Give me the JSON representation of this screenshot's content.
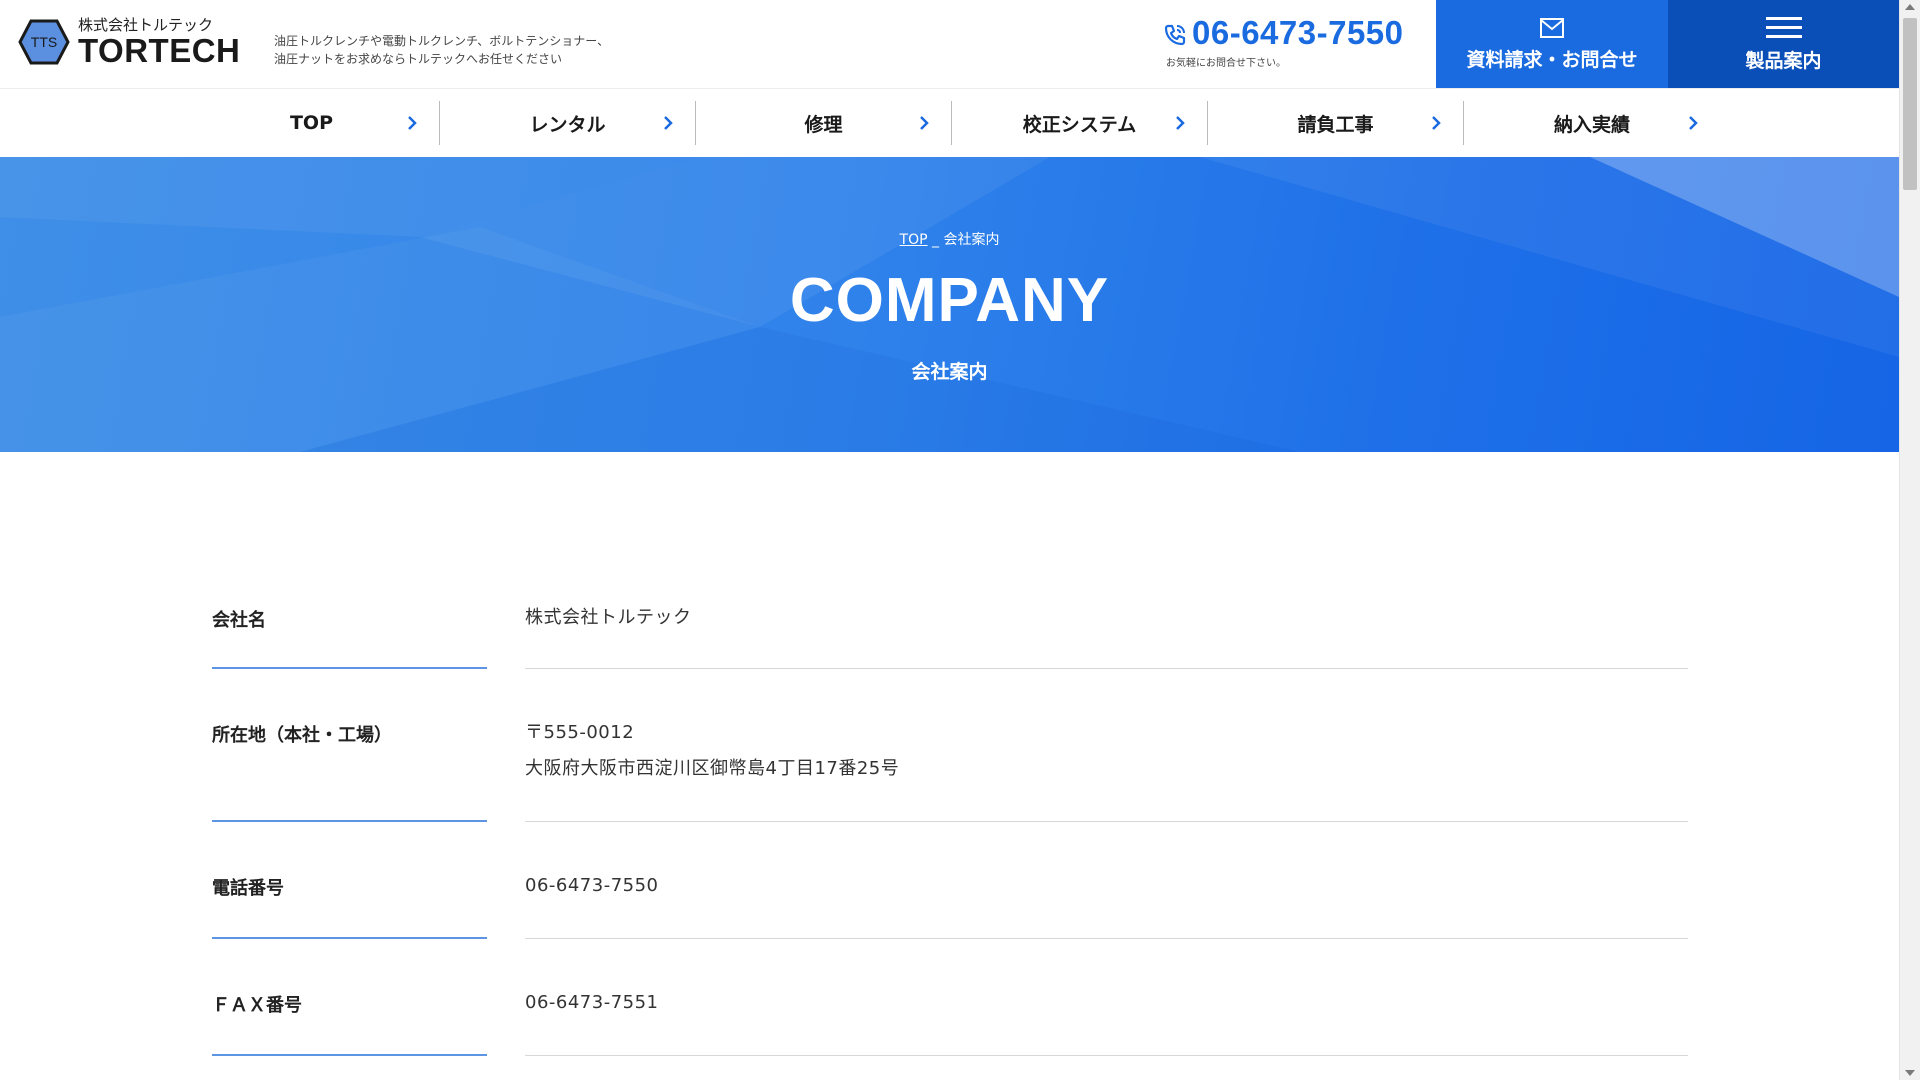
{
  "header": {
    "logo_mark": "TTS",
    "logo_sub": "株式会社トルテック",
    "logo_main": "TORTECH",
    "tagline_line1": "油圧トルクレンチや電動トルクレンチ、ボルトテンショナー、",
    "tagline_line2": "油圧ナットをお求めならトルテックへお任せください",
    "phone_number": "06-6473-7550",
    "phone_note": "お気軽にお問合せ下さい。",
    "contact_button": "資料請求・お問合せ",
    "products_button": "製品案内",
    "accent_color": "#1a6ae0"
  },
  "nav": {
    "items": [
      {
        "label": "TOP"
      },
      {
        "label": "レンタル"
      },
      {
        "label": "修理"
      },
      {
        "label": "校正システム"
      },
      {
        "label": "請負工事"
      },
      {
        "label": "納入実績"
      }
    ]
  },
  "hero": {
    "breadcrumb_home": "TOP",
    "breadcrumb_current": "会社案内",
    "title": "COMPANY",
    "subtitle": "会社案内"
  },
  "company": {
    "rows": [
      {
        "label": "会社名",
        "value": "株式会社トルテック"
      },
      {
        "label": "所在地（本社・工場）",
        "value_line1": "〒555-0012",
        "value_line2": "大阪府大阪市西淀川区御幣島4丁目17番25号"
      },
      {
        "label": "電話番号",
        "value": "06-6473-7550"
      },
      {
        "label": "ＦＡＸ番号",
        "value": "06-6473-7551"
      }
    ]
  }
}
